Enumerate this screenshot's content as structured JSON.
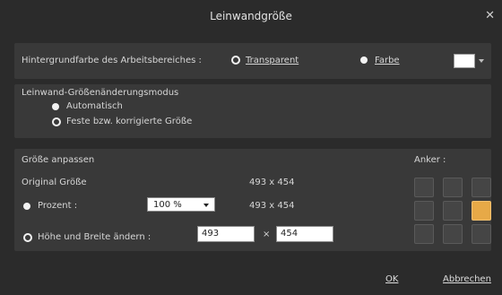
{
  "window": {
    "title": "Leinwandgröße",
    "close_icon": "close-icon"
  },
  "background": {
    "label": "Hintergrundfarbe des Arbeitsbereiches :",
    "option_transparent": "Transparent",
    "option_color": "Farbe",
    "selected": "transparent",
    "color_swatch": "#ffffff"
  },
  "resize_mode": {
    "heading": "Leinwand-Größenänderungsmodus",
    "option_auto": "Automatisch",
    "option_fixed": "Feste bzw. korrigierte Größe",
    "selected": "auto"
  },
  "size": {
    "heading": "Größe anpassen",
    "original_label": "Original Größe",
    "original_value": "493 x 454",
    "percent_label": "Prozent :",
    "percent_value": "100 %",
    "percent_result": "493 x 454",
    "hw_label": "Höhe und Breite ändern :",
    "width_value": "493",
    "times_sign": "×",
    "height_value": "454",
    "selected": "percent"
  },
  "anchor": {
    "label": "Anker :",
    "active_index": 5
  },
  "buttons": {
    "ok": "OK",
    "cancel": "Abbrechen"
  }
}
